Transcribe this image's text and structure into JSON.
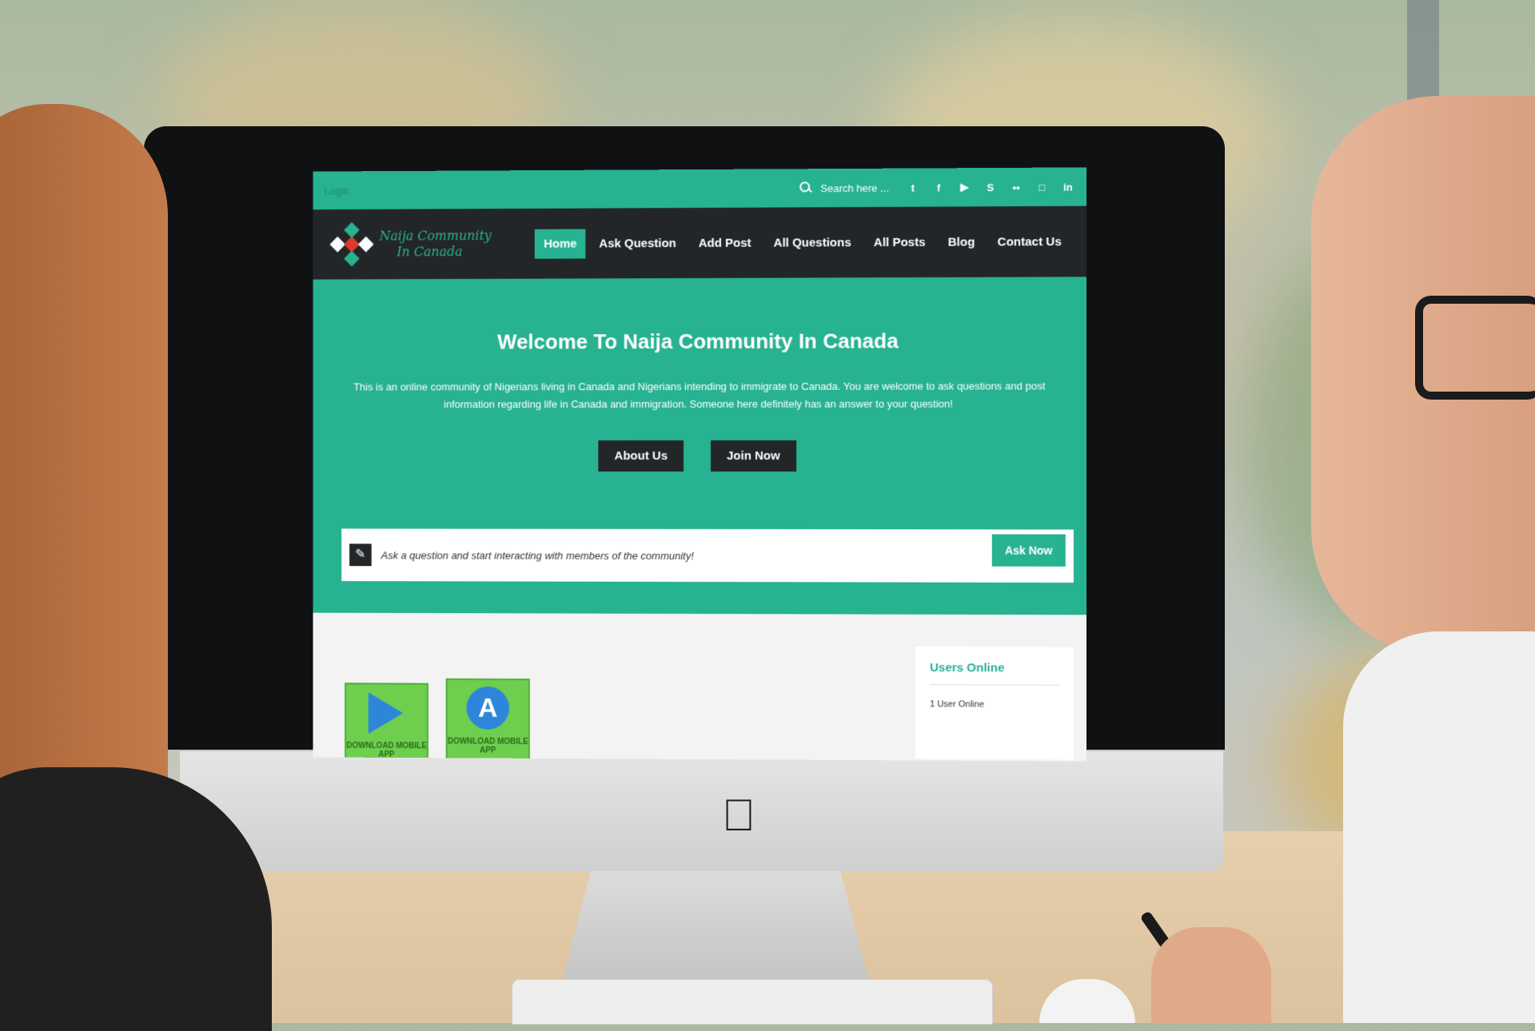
{
  "topbar": {
    "login_label": "Login",
    "search_placeholder": "Search here ...",
    "social_icons": [
      "twitter-icon",
      "facebook-icon",
      "youtube-icon",
      "skype-icon",
      "flickr-icon",
      "instagram-icon",
      "linkedin-icon"
    ]
  },
  "header": {
    "logo_line1": "Naija Community",
    "logo_line2": "In Canada"
  },
  "nav": {
    "items": [
      {
        "label": "Home"
      },
      {
        "label": "Ask Question"
      },
      {
        "label": "Add Post"
      },
      {
        "label": "All Questions"
      },
      {
        "label": "All Posts"
      },
      {
        "label": "Blog"
      },
      {
        "label": "Contact Us"
      }
    ]
  },
  "hero": {
    "title": "Welcome To Naija Community In Canada",
    "text": "This is an online community of Nigerians living in Canada and Nigerians intending to immigrate to Canada. You are welcome to ask questions and post information regarding life in Canada and immigration. Someone here definitely has an answer to your question!",
    "about_label": "About Us",
    "join_label": "Join Now",
    "ask_prompt": "Ask a question and start interacting with members of the community!",
    "ask_button": "Ask Now"
  },
  "apps": {
    "play_caption": "DOWNLOAD MOBILE APP",
    "appstore_caption": "DOWNLOAD MOBILE APP"
  },
  "sidebar": {
    "users_online_title": "Users Online",
    "users_online_count": "1 User Online"
  },
  "colors": {
    "accent": "#27b291",
    "dark": "#232628"
  }
}
